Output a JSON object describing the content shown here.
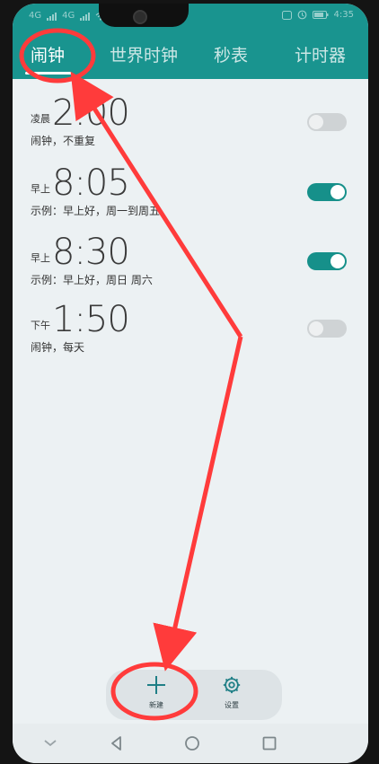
{
  "status_bar": {
    "signal_1": "4G",
    "signal_2": "4G",
    "time": "4:35"
  },
  "tabs": [
    {
      "label": "闹钟",
      "active": true
    },
    {
      "label": "世界时钟",
      "active": false
    },
    {
      "label": "秒表",
      "active": false
    },
    {
      "label": "计时器",
      "active": false
    }
  ],
  "alarms": [
    {
      "period": "凌晨",
      "time": "2:00",
      "subtitle": "闹钟，不重复",
      "enabled": false
    },
    {
      "period": "早上",
      "time": "8:05",
      "subtitle": "示例：早上好，周一到周五",
      "enabled": true
    },
    {
      "period": "早上",
      "time": "8:30",
      "subtitle": "示例：早上好，周日 周六",
      "enabled": true
    },
    {
      "period": "下午",
      "time": "1:50",
      "subtitle": "闹钟，每天",
      "enabled": false
    }
  ],
  "actions": {
    "new_label": "新建",
    "settings_label": "设置"
  },
  "colors": {
    "accent": "#19948f",
    "toggle_on": "#16908a",
    "annotation": "#ff3b3b"
  },
  "icons": {
    "add": "plus-icon",
    "settings": "gear-icon"
  }
}
